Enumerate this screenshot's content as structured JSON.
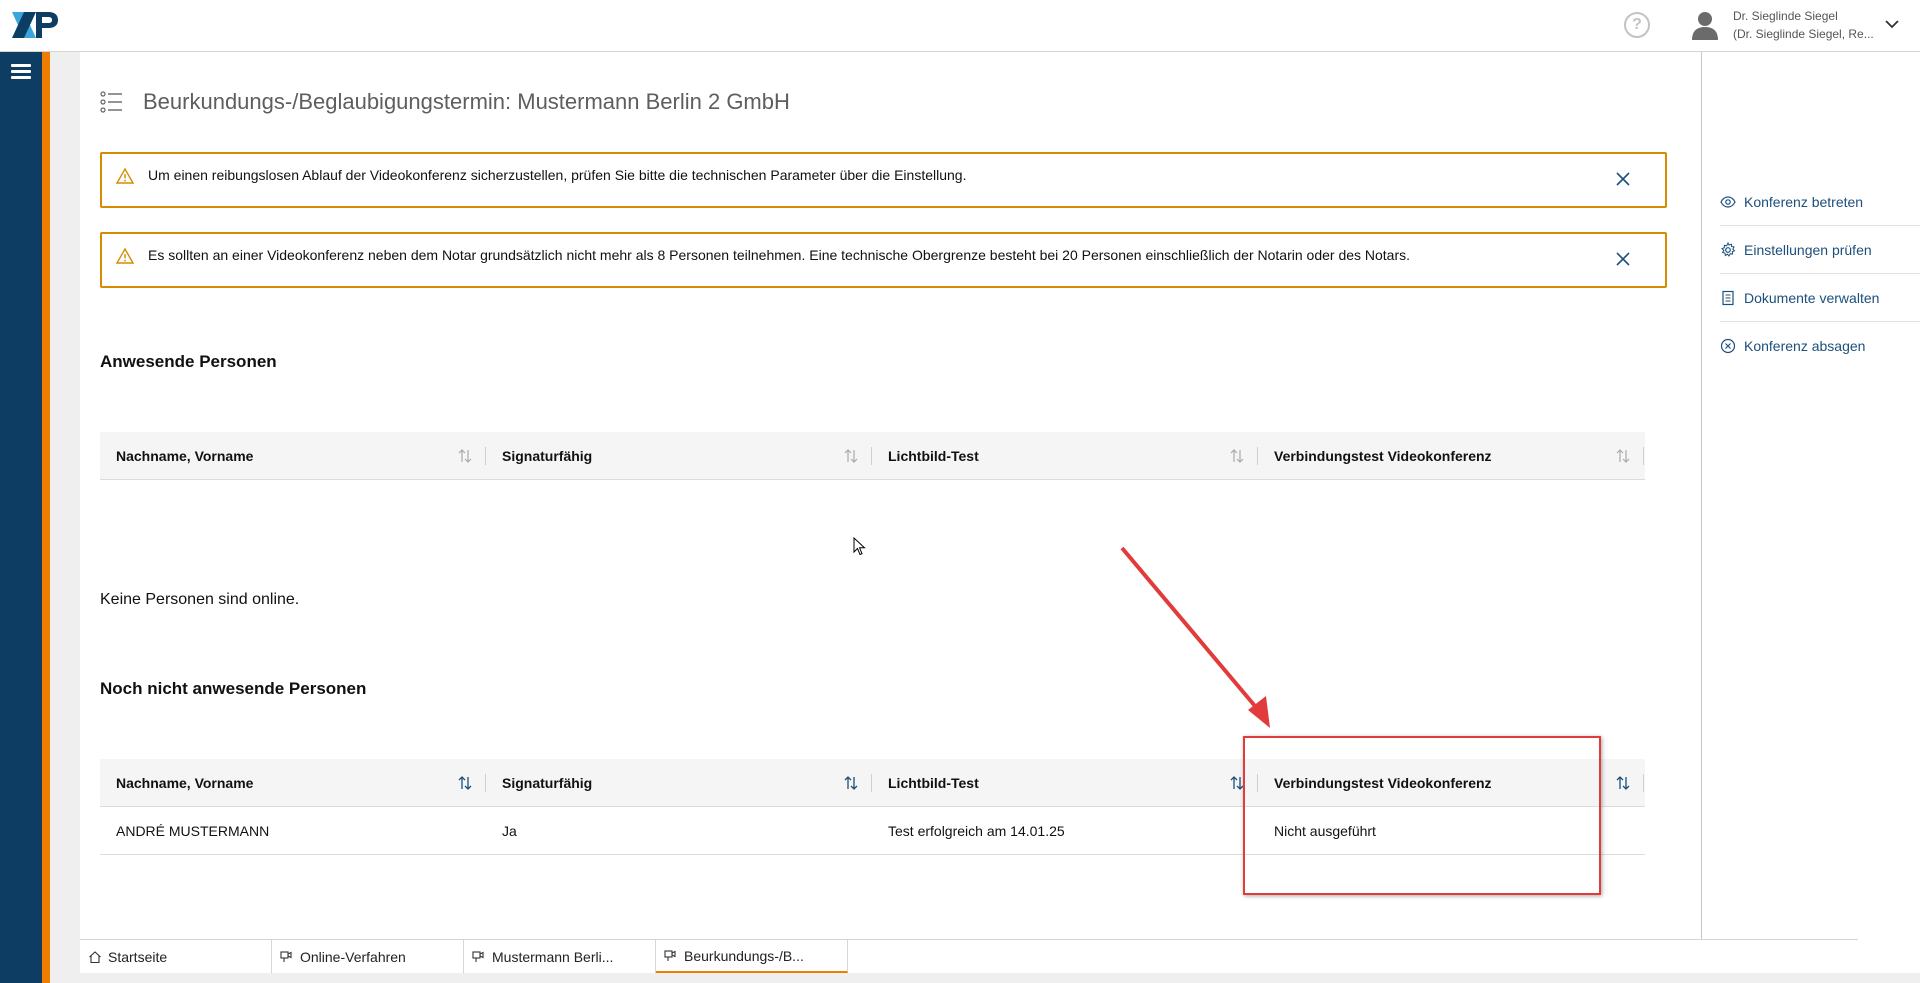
{
  "header": {
    "logo": "XNP",
    "help_icon": "help-circle-icon",
    "user_name": "Dr. Sieglinde Siegel",
    "user_subtitle": "(Dr. Sieglinde Siegel, Re..."
  },
  "page": {
    "title": "Beurkundungs-/Beglaubigungstermin: Mustermann Berlin 2 GmbH"
  },
  "alerts": [
    {
      "text": "Um einen reibungslosen Ablauf der Videokonferenz sicherzustellen, prüfen Sie bitte die technischen Parameter über die Einstellung."
    },
    {
      "text": "Es sollten an einer Videokonferenz neben dem Notar grundsätzlich nicht mehr als 8 Personen teilnehmen. Eine technische Obergrenze besteht bei 20 Personen einschließlich der Notarin oder des Notars."
    }
  ],
  "present": {
    "title": "Anwesende Personen",
    "columns": [
      "Nachname, Vorname",
      "Signaturfähig",
      "Lichtbild-Test",
      "Verbindungstest Videokonferenz"
    ],
    "empty_text": "Keine Personen sind online."
  },
  "absent": {
    "title": "Noch nicht anwesende Personen",
    "columns": [
      "Nachname, Vorname",
      "Signaturfähig",
      "Lichtbild-Test",
      "Verbindungstest Videokonferenz"
    ],
    "rows": [
      [
        "ANDRÉ MUSTERMANN",
        "Ja",
        "Test erfolgreich am 14.01.25",
        "Nicht ausgeführt"
      ]
    ]
  },
  "actions": [
    {
      "label": "Konferenz betreten",
      "icon": "eye-icon"
    },
    {
      "label": "Einstellungen prüfen",
      "icon": "gear-icon"
    },
    {
      "label": "Dokumente verwalten",
      "icon": "document-icon"
    },
    {
      "label": "Konferenz absagen",
      "icon": "cancel-circle-icon"
    }
  ],
  "tabs": [
    {
      "label": "Startseite",
      "icon": "home-icon"
    },
    {
      "label": "Online-Verfahren",
      "icon": "video-icon"
    },
    {
      "label": "Mustermann Berli...",
      "icon": "video-icon"
    },
    {
      "label": "Beurkundungs-/B...",
      "icon": "video-icon"
    }
  ],
  "colors": {
    "rail": "#0e3d63",
    "accent": "#f07d00",
    "alert_border": "#d68b00",
    "link": "#1d4f7c",
    "annotation": "#e23b3b"
  }
}
